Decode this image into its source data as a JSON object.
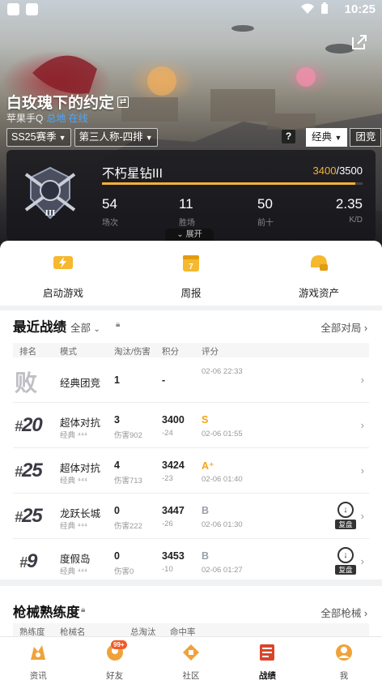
{
  "status_bar": {
    "time": "10:25"
  },
  "hero": {
    "title": "白玫瑰下的约定",
    "sub_prefix": "苹果手Q",
    "sub_link": "·总地 在线"
  },
  "filters": {
    "season": "SS25赛季",
    "perspective": "第三人称-四排",
    "help": "?",
    "mode_active": "经典",
    "mode_other": "团竞"
  },
  "rank": {
    "name": "不朽星钻III",
    "score_current": "3400",
    "score_total": "/3500",
    "progress": 0.971
  },
  "stats": [
    {
      "value": "54",
      "label": "场次"
    },
    {
      "value": "11",
      "label": "胜场"
    },
    {
      "value": "50",
      "label": "前十"
    },
    {
      "value": "2.35",
      "label": "K/D"
    }
  ],
  "expand_label": "展开",
  "quick_actions": [
    {
      "label": "启动游戏",
      "icon": "lightning-icon"
    },
    {
      "label": "周报",
      "icon": "calendar-icon"
    },
    {
      "label": "游戏资产",
      "icon": "helmet-icon"
    }
  ],
  "recent": {
    "title": "最近战绩",
    "filter": "全部",
    "more": "全部对局",
    "columns": [
      "排名",
      "模式",
      "淘汰/伤害",
      "积分",
      "评分"
    ],
    "matches": [
      {
        "rank": "败",
        "mode": "经典团竞",
        "sub": "",
        "kills": "1",
        "damage": "",
        "points": "-",
        "delta": "",
        "grade": "",
        "grade_color": "#999",
        "time": "02-06 22:33",
        "replay": false
      },
      {
        "rank": "20",
        "mode": "超体对抗",
        "sub": "经典 ⁴⁴⁴",
        "kills": "3",
        "damage": "伤害902",
        "points": "3400",
        "delta": "-24",
        "grade": "S",
        "grade_color": "#f3a41a",
        "time": "02-06 01:55",
        "replay": false
      },
      {
        "rank": "25",
        "mode": "超体对抗",
        "sub": "经典 ⁴⁴⁴",
        "kills": "4",
        "damage": "伤害713",
        "points": "3424",
        "delta": "-23",
        "grade": "A⁺",
        "grade_color": "#f3a41a",
        "time": "02-06 01:40",
        "replay": false
      },
      {
        "rank": "25",
        "mode": "龙跃长城",
        "sub": "经典 ⁴⁴⁴",
        "kills": "0",
        "damage": "伤害222",
        "points": "3447",
        "delta": "-26",
        "grade": "B",
        "grade_color": "#9aa0aa",
        "time": "02-06 01:30",
        "replay": true
      },
      {
        "rank": "9",
        "mode": "度假岛",
        "sub": "经典 ⁴⁴⁴",
        "kills": "0",
        "damage": "伤害0",
        "points": "3453",
        "delta": "-10",
        "grade": "B",
        "grade_color": "#9aa0aa",
        "time": "02-06 01:27",
        "replay": true
      }
    ],
    "replay_label": "复盘"
  },
  "guns": {
    "title": "枪械熟练度",
    "more": "全部枪械",
    "columns": [
      "熟练度",
      "枪械名",
      "总淘汰",
      "命中率"
    ]
  },
  "nav": [
    {
      "label": "资讯",
      "icon": "news-icon"
    },
    {
      "label": "好友",
      "icon": "friends-icon",
      "badge": "99+"
    },
    {
      "label": "社区",
      "icon": "community-icon"
    },
    {
      "label": "战绩",
      "icon": "record-icon",
      "active": true
    },
    {
      "label": "我",
      "icon": "me-icon"
    }
  ],
  "colors": {
    "accent": "#f3b13a",
    "dark": "#1c1c1f"
  }
}
